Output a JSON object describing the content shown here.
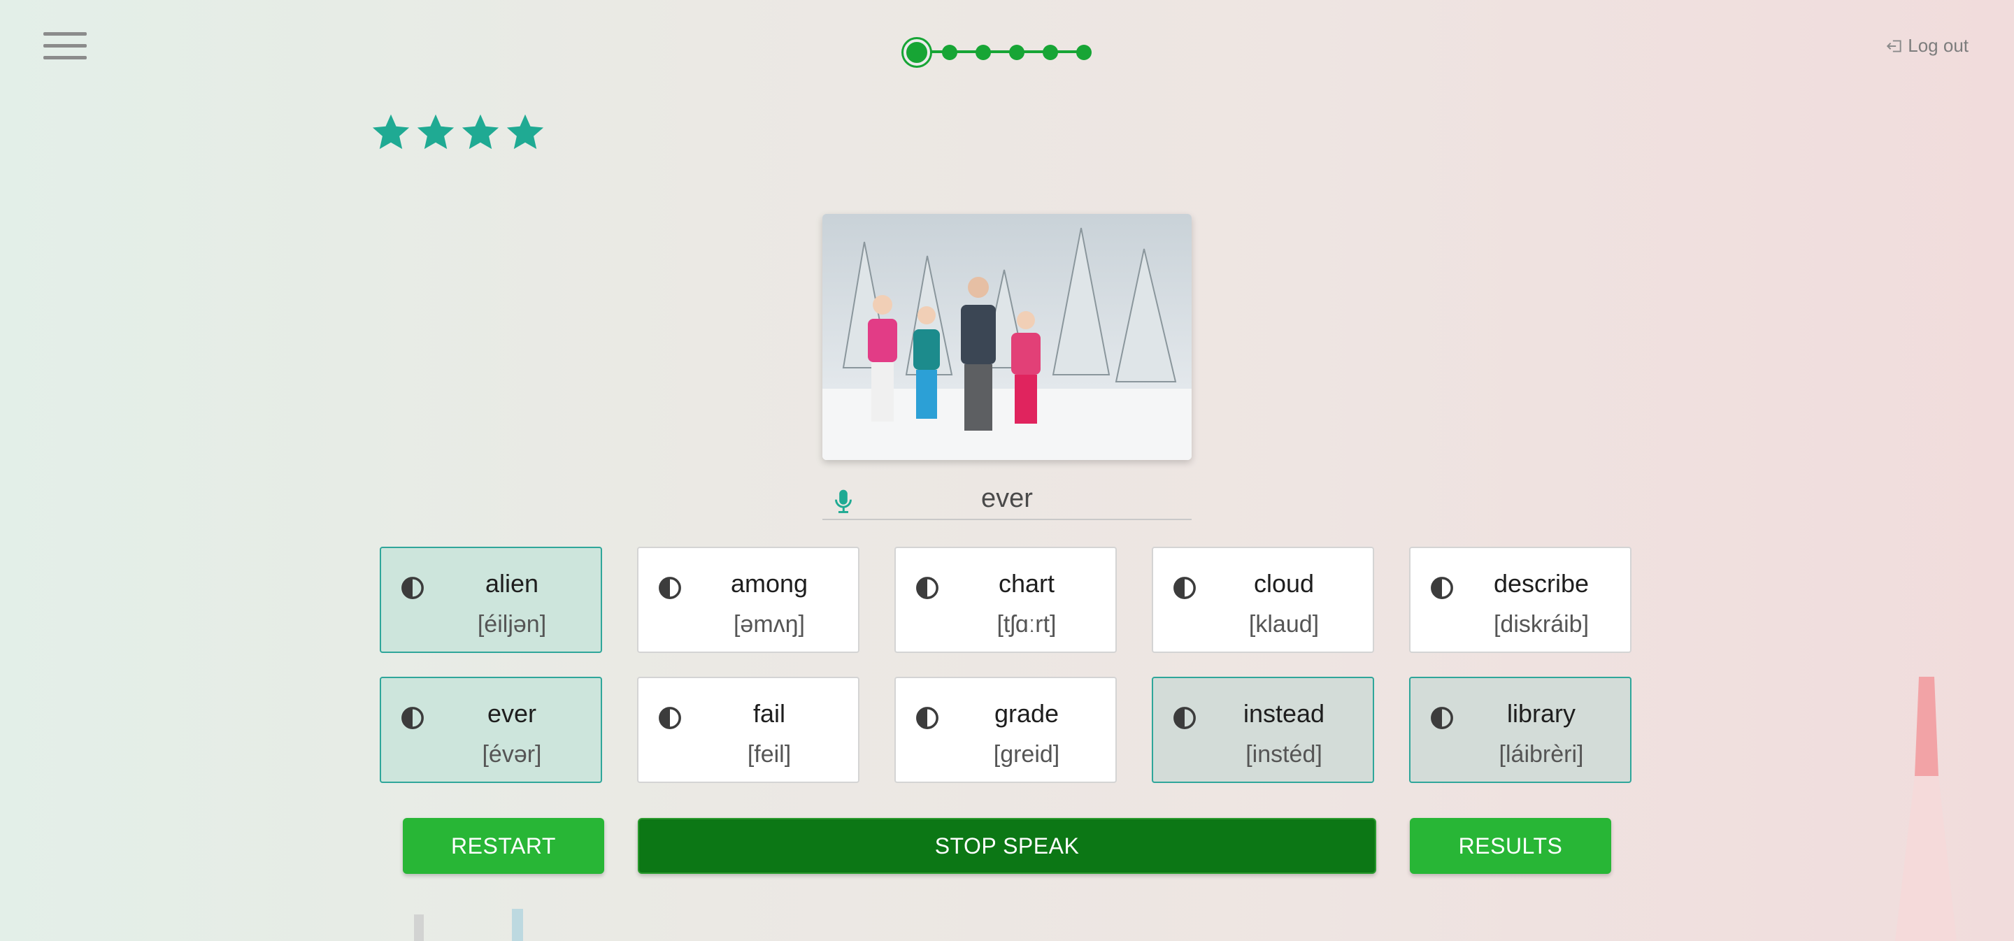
{
  "header": {
    "logout_label": "Log out",
    "progress": {
      "total_steps": 6,
      "current_step": 1
    }
  },
  "stars": {
    "count": 4,
    "color": "#1faa93"
  },
  "photo": {
    "alt": "Family standing in snow with skis"
  },
  "speech": {
    "recognized_text": "ever"
  },
  "words": [
    {
      "word": "alien",
      "ipa": "[éiljən]",
      "state": "teal"
    },
    {
      "word": "among",
      "ipa": "[əmʌŋ]",
      "state": "plain"
    },
    {
      "word": "chart",
      "ipa": "[tʃɑːrt]",
      "state": "plain"
    },
    {
      "word": "cloud",
      "ipa": "[klaud]",
      "state": "plain"
    },
    {
      "word": "describe",
      "ipa": "[diskráib]",
      "state": "plain"
    },
    {
      "word": "ever",
      "ipa": "[évər]",
      "state": "teal"
    },
    {
      "word": "fail",
      "ipa": "[feil]",
      "state": "plain"
    },
    {
      "word": "grade",
      "ipa": "[greid]",
      "state": "plain"
    },
    {
      "word": "instead",
      "ipa": "[instéd]",
      "state": "grey"
    },
    {
      "word": "library",
      "ipa": "[láibrèri]",
      "state": "grey"
    }
  ],
  "buttons": {
    "restart": "RESTART",
    "stop_speak": "STOP SPEAK",
    "results": "RESULTS"
  },
  "colors": {
    "accent_green": "#28b636",
    "dark_green": "#0c7715",
    "teal": "#1faa93"
  }
}
